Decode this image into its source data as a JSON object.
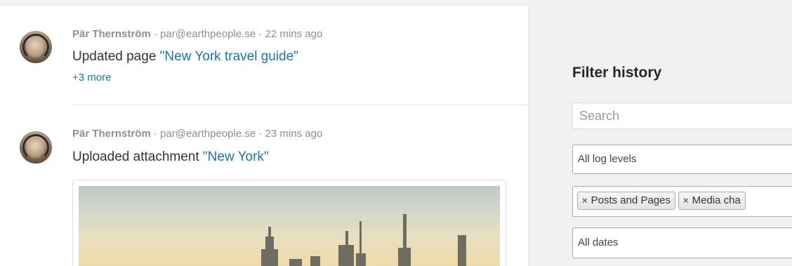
{
  "feed": {
    "entries": [
      {
        "user_name": "Pär Thernström",
        "email": "par@earthpeople.se",
        "time": "22 mins ago",
        "action": "Updated page",
        "object": "\"New York travel guide\"",
        "more": "+3 more"
      },
      {
        "user_name": "Pär Thernström",
        "email": "par@earthpeople.se",
        "time": "23 mins ago",
        "action": "Uploaded attachment",
        "object": "\"New York\""
      }
    ],
    "separator": " · "
  },
  "filter": {
    "title": "Filter history",
    "search_placeholder": "Search",
    "log_levels": "All log levels",
    "tags": [
      {
        "remove": "×",
        "label": "Posts and Pages"
      },
      {
        "remove": "×",
        "label": "Media cha"
      }
    ],
    "dates": "All dates"
  },
  "colors": {
    "link": "#21759b",
    "meta": "#8f8f8f",
    "text": "#333333"
  }
}
